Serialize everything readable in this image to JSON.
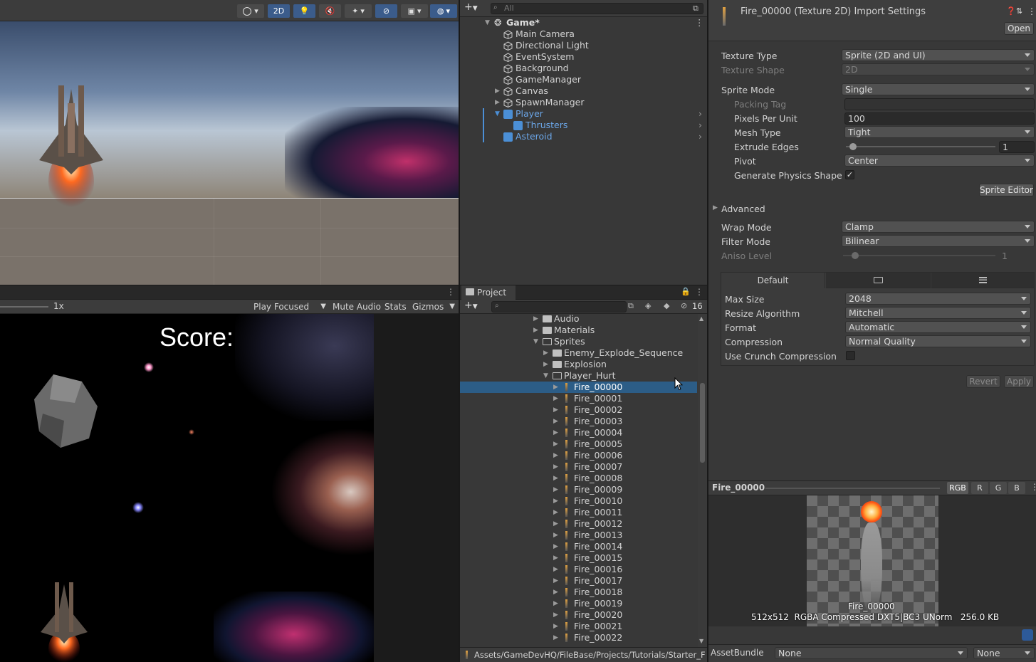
{
  "scene": {
    "toolbar": {
      "mode_2d": "2D"
    }
  },
  "game": {
    "scale_label": "1x",
    "play_focused": "Play Focused",
    "mute_audio": "Mute Audio",
    "stats": "Stats",
    "gizmos": "Gizmos",
    "score_text": "Score:"
  },
  "hierarchy": {
    "search_placeholder": "All",
    "scene_name": "Game*",
    "items": [
      {
        "label": "Main Camera"
      },
      {
        "label": "Directional Light"
      },
      {
        "label": "EventSystem"
      },
      {
        "label": "Background"
      },
      {
        "label": "GameManager"
      },
      {
        "label": "Canvas"
      },
      {
        "label": "SpawnManager"
      },
      {
        "label": "Player"
      },
      {
        "label": "Thrusters"
      },
      {
        "label": "Asteroid"
      }
    ]
  },
  "project": {
    "tab": "Project",
    "hidden_count": "16",
    "tree": [
      {
        "label": "Audio"
      },
      {
        "label": "Materials"
      },
      {
        "label": "Sprites"
      },
      {
        "label": "Enemy_Explode_Sequence"
      },
      {
        "label": "Explosion"
      },
      {
        "label": "Player_Hurt"
      }
    ],
    "files": [
      "Fire_00000",
      "Fire_00001",
      "Fire_00002",
      "Fire_00003",
      "Fire_00004",
      "Fire_00005",
      "Fire_00006",
      "Fire_00007",
      "Fire_00008",
      "Fire_00009",
      "Fire_00010",
      "Fire_00011",
      "Fire_00012",
      "Fire_00013",
      "Fire_00014",
      "Fire_00015",
      "Fire_00016",
      "Fire_00017",
      "Fire_00018",
      "Fire_00019",
      "Fire_00020",
      "Fire_00021",
      "Fire_00022"
    ],
    "path": "Assets/GameDevHQ/FileBase/Projects/Tutorials/Starter_F"
  },
  "inspector": {
    "title": "Fire_00000 (Texture 2D) Import Settings",
    "open": "Open",
    "texture_type_label": "Texture Type",
    "texture_type": "Sprite (2D and UI)",
    "texture_shape_label": "Texture Shape",
    "texture_shape": "2D",
    "sprite_mode_label": "Sprite Mode",
    "sprite_mode": "Single",
    "packing_tag_label": "Packing Tag",
    "packing_tag": "",
    "ppu_label": "Pixels Per Unit",
    "ppu": "100",
    "mesh_type_label": "Mesh Type",
    "mesh_type": "Tight",
    "extrude_label": "Extrude Edges",
    "extrude": "1",
    "pivot_label": "Pivot",
    "pivot": "Center",
    "gen_physics_label": "Generate Physics Shape",
    "sprite_editor": "Sprite Editor",
    "advanced": "Advanced",
    "wrap_label": "Wrap Mode",
    "wrap": "Clamp",
    "filter_label": "Filter Mode",
    "filter": "Bilinear",
    "aniso_label": "Aniso Level",
    "aniso": "1",
    "platform_default": "Default",
    "max_size_label": "Max Size",
    "max_size": "2048",
    "resize_label": "Resize Algorithm",
    "resize": "Mitchell",
    "format_label": "Format",
    "format": "Automatic",
    "compression_label": "Compression",
    "compression": "Normal Quality",
    "crunch_label": "Use Crunch Compression",
    "revert": "Revert",
    "apply": "Apply",
    "preview_name": "Fire_00000",
    "channels": [
      "RGB",
      "R",
      "G",
      "B"
    ],
    "preview_caption": "Fire_00000",
    "preview_info": "512x512  RGBA Compressed DXT5|BC3 UNorm   256.0 KB",
    "asset_bundle_label": "AssetBundle",
    "bundle_value": "None",
    "bundle_variant": "None"
  }
}
